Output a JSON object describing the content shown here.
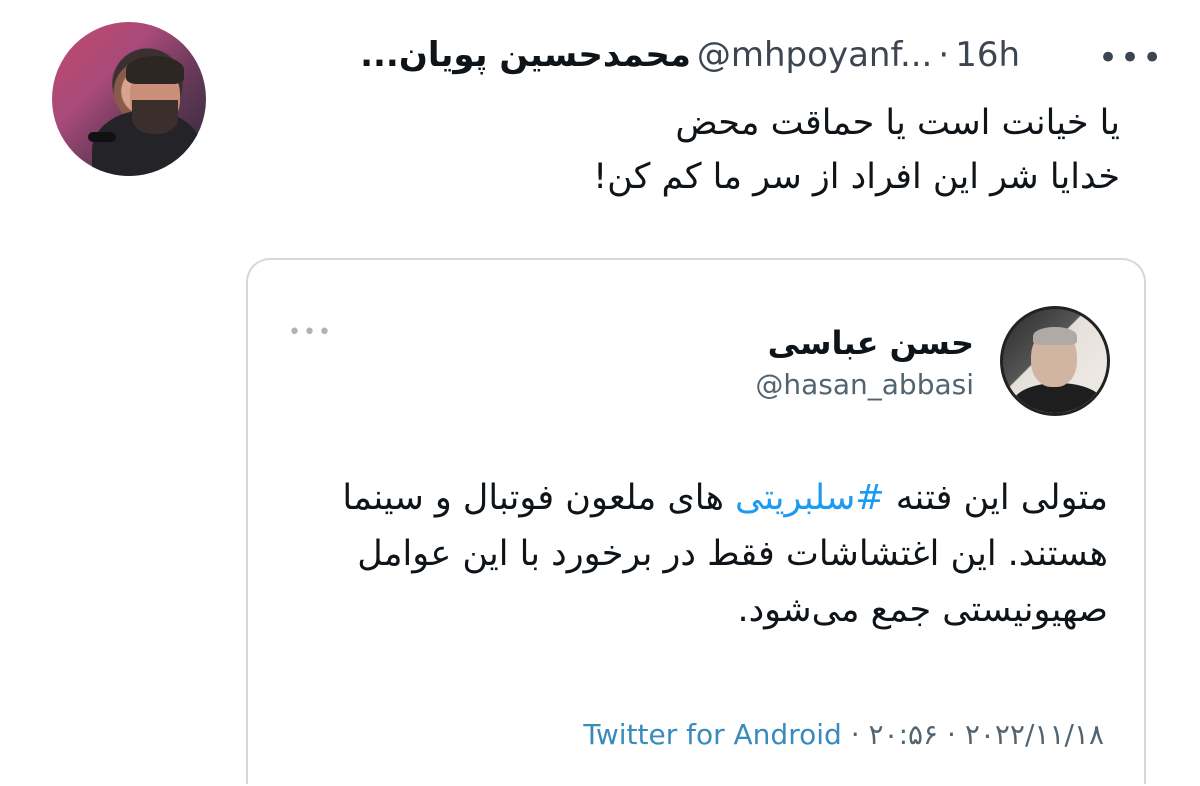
{
  "main_tweet": {
    "display_name": "محمدحسین پویان...",
    "handle": "@mhpoyanf...",
    "separator": "·",
    "time": "16h",
    "more_label": "•••",
    "text_line_1": "یا خیانت است یا حماقت محض",
    "text_line_2": "خدایا شر این افراد از سر ما کم کن!"
  },
  "quote_tweet": {
    "display_name": "حسن عباسی",
    "handle": "@hasan_abbasi",
    "more_label": "•••",
    "text_before_hashtag": "متولی این فتنه",
    "hashtag": "#سلبریتی",
    "text_after_hashtag": "های ملعون فوتبال و سینما هستند. این اغتشاشات فقط در برخورد با این عوامل صهیونیستی جمع می‌شود.",
    "source": "Twitter for Android",
    "meta_separator_1": "·",
    "time": "۲۰:۵۶",
    "meta_separator_2": "·",
    "date": "۲۰۲۲/۱۱/۱۸"
  },
  "colors": {
    "link_blue": "#1d9bf0",
    "secondary_text": "#536471",
    "border": "#cfd9de"
  }
}
